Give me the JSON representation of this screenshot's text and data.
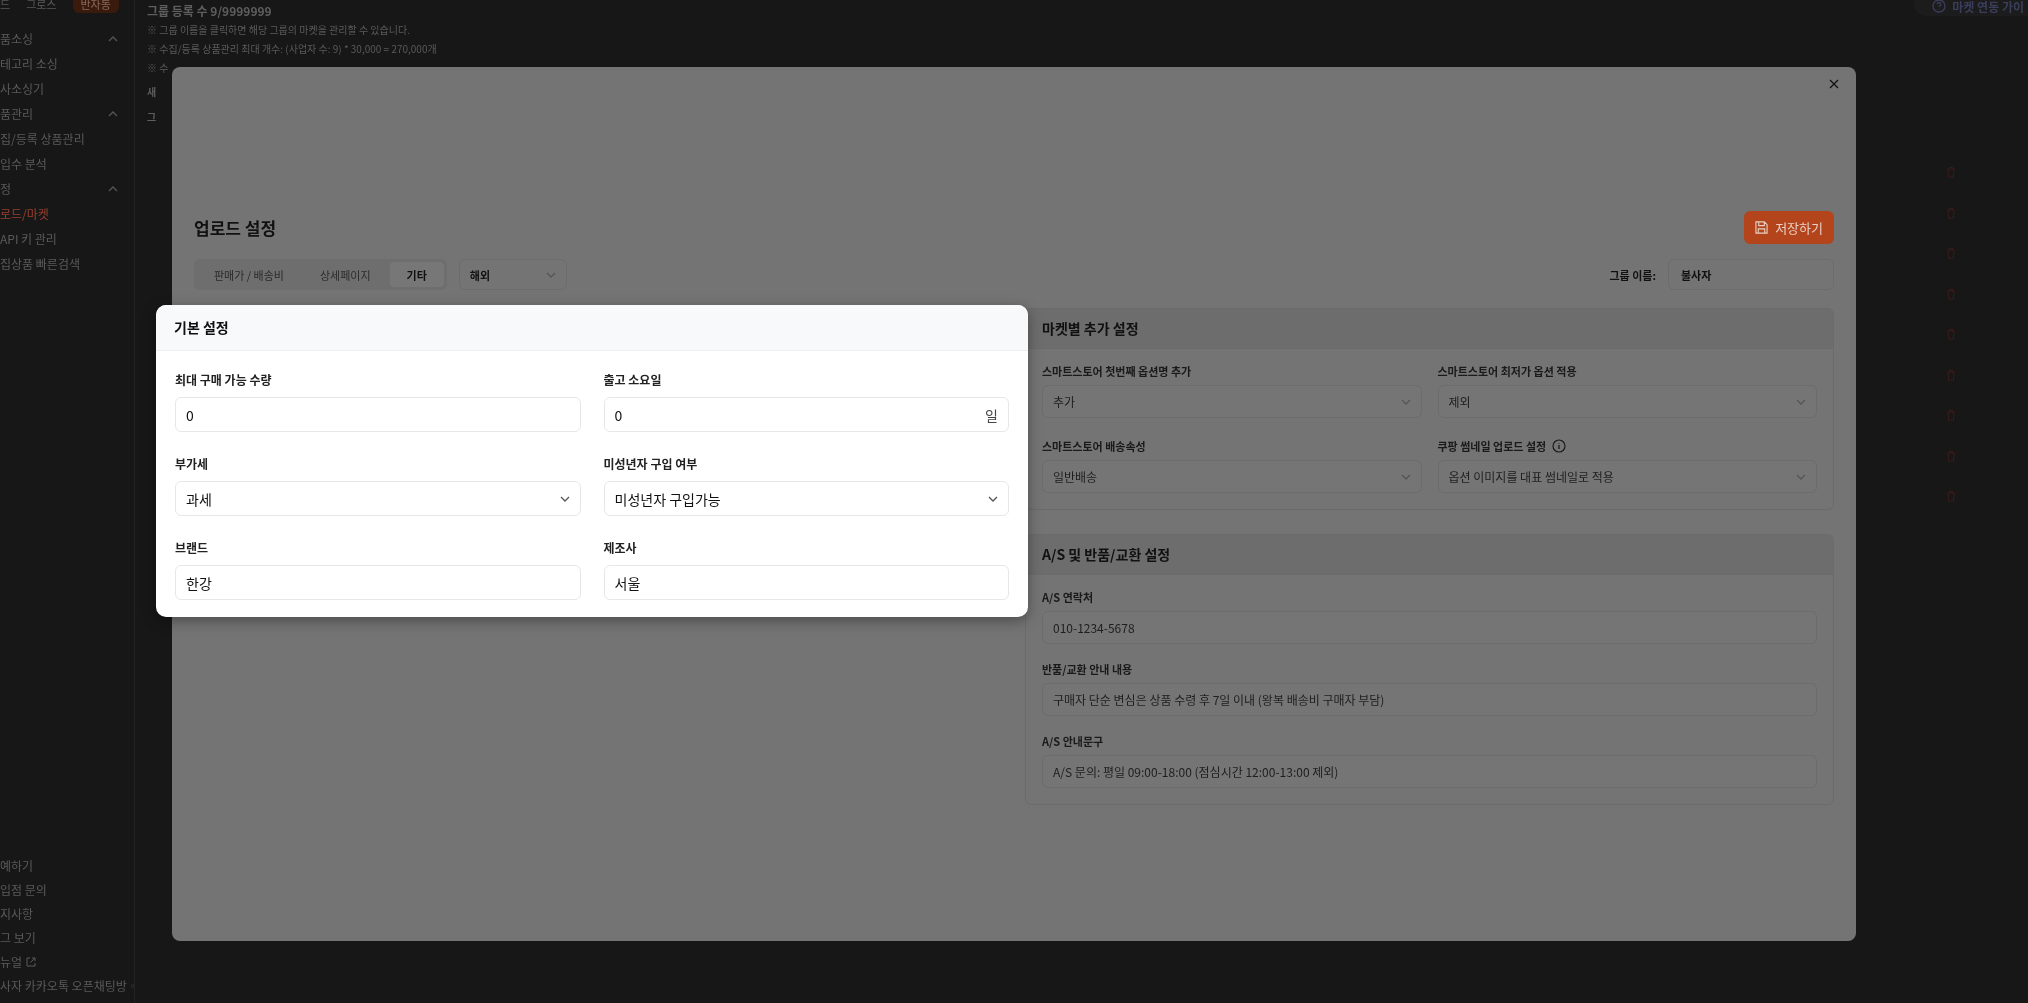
{
  "sidebar": {
    "top_items": [
      {
        "label": "드",
        "selected": false
      },
      {
        "label": "그로스",
        "selected": false
      },
      {
        "label": "반자동",
        "selected": true
      }
    ],
    "sections": [
      {
        "label": "품소싱",
        "expanded": true,
        "items": [
          {
            "label": "테고리 소싱",
            "selected": false
          },
          {
            "label": "사소싱기",
            "selected": false
          }
        ]
      },
      {
        "label": "품관리",
        "expanded": true,
        "items": [
          {
            "label": "집/등록 상품관리",
            "selected": false
          },
          {
            "label": "입수 분석",
            "selected": false
          }
        ]
      },
      {
        "label": "정",
        "expanded": true,
        "items": [
          {
            "label": "로드/마켓",
            "selected": true
          },
          {
            "label": "API 키 관리",
            "selected": false
          },
          {
            "label": "집상품 빠른검색",
            "selected": false
          }
        ]
      }
    ],
    "footer_items": [
      {
        "label": "예하기",
        "external": false
      },
      {
        "label": "입점 문의",
        "external": false
      },
      {
        "label": "지사항",
        "external": false
      },
      {
        "label": "그 보기",
        "external": false
      },
      {
        "label": "뉴얼",
        "external": true
      },
      {
        "label": "사자 카카오톡 오픈채팅방",
        "external": true
      }
    ]
  },
  "page": {
    "count_line": "그룹 등록 수 9/9999999",
    "guide_button": "마켓 연동 가이",
    "notes": [
      "※ 그룹 이름을 클릭하면 해당 그룹의 마켓을 관리할 수 있습니다.",
      "※ 수집/등록 상품관리 최대 개수: (사업자 수: 9) * 30,000 = 270,000개",
      "※ 수"
    ],
    "fragments": [
      "새",
      "그"
    ]
  },
  "modal": {
    "title": "업로드 설정",
    "save_button": "저장하기",
    "tabs": [
      {
        "label": "판매가 / 배송비",
        "selected": false
      },
      {
        "label": "상세페이지",
        "selected": false
      },
      {
        "label": "기타",
        "selected": true
      }
    ],
    "region_select": "해외",
    "group_name_label": "그룹 이름:",
    "group_name": "불사자",
    "basic_card": {
      "title": "기본 설정",
      "fields": [
        {
          "label": "최대 구매 가능 수량",
          "kind": "input",
          "value": "0"
        },
        {
          "label": "출고 소요일",
          "kind": "input",
          "value": "0",
          "suffix": "일"
        },
        {
          "label": "부가세",
          "kind": "select",
          "value": "과세"
        },
        {
          "label": "미성년자 구입 여부",
          "kind": "select",
          "value": "미성년자 구입가능"
        },
        {
          "label": "브랜드",
          "kind": "input",
          "value": "한강"
        },
        {
          "label": "제조사",
          "kind": "input",
          "value": "서울"
        }
      ]
    },
    "market_panel": {
      "title": "마켓별 추가 설정",
      "fields": [
        {
          "label": "스마트스토어 첫번째 옵션명 추가",
          "kind": "select",
          "value": "추가",
          "info": false
        },
        {
          "label": "스마트스토어 최저가 옵션 적용",
          "kind": "select",
          "value": "제외",
          "info": false
        },
        {
          "label": "스마트스토어 배송속성",
          "kind": "select",
          "value": "일반배송",
          "info": false
        },
        {
          "label": "쿠팡 썸네일 업로드 설정",
          "kind": "select",
          "value": "옵션 이미지를 대표 썸네일로 적용",
          "info": true
        }
      ]
    },
    "as_panel": {
      "title": "A/S 및 반품/교환 설정",
      "fields": [
        {
          "label": "A/S 연락처",
          "kind": "input",
          "value": "010-1234-5678"
        },
        {
          "label": "반품/교환 안내 내용",
          "kind": "input",
          "value": "구매자 단순 변심은 상품 수령 후 7일 이내 (왕복 배송비 구매자 부담)"
        },
        {
          "label": "A/S 안내문구",
          "kind": "input",
          "value": "A/S 문의: 평일 09:00-18:00 (점심시간 12:00-13:00 제외)"
        }
      ]
    }
  }
}
